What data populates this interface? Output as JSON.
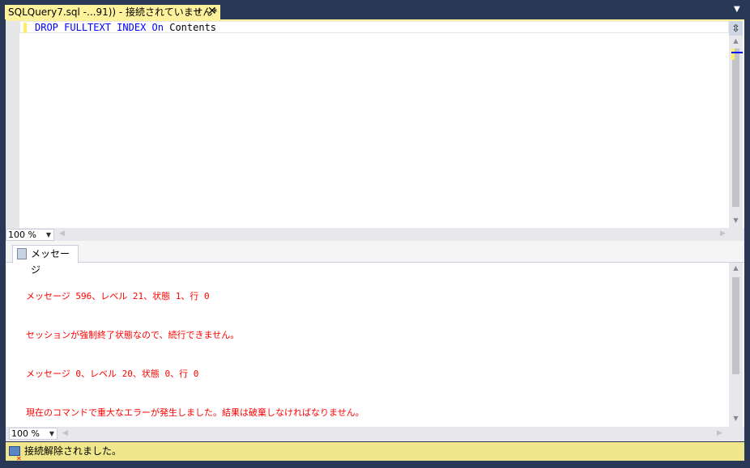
{
  "tab": {
    "title": "SQLQuery7.sql -...91)) - 接続されていません*",
    "pin_icon": "pin-icon",
    "close_icon": "close-icon"
  },
  "editor": {
    "code": {
      "kw1": "DROP",
      "kw2": "FULLTEXT",
      "kw3": "INDEX",
      "kw4": "On",
      "ident": "Contents"
    },
    "zoom": "100 %"
  },
  "results": {
    "tab_label": "メッセージ",
    "messages": [
      "メッセージ 596、レベル 21、状態 1、行 0",
      "セッションが強制終了状態なので、続行できません。",
      "メッセージ 0、レベル 20、状態 0、行 0",
      "現在のコマンドで重大なエラーが発生しました。結果は破棄しなければなりません。"
    ],
    "zoom": "100 %"
  },
  "status": {
    "text": "接続解除されました。"
  },
  "colors": {
    "background": "#293955",
    "tab": "#FFF29D",
    "error": "#FF0000",
    "keyword": "#0000FF",
    "status": "#F0E68C"
  }
}
